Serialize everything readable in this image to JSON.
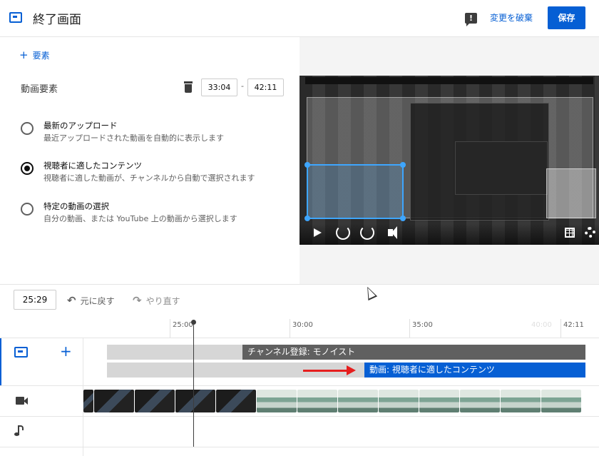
{
  "header": {
    "title": "終了画面",
    "discard_label": "変更を破棄",
    "save_label": "保存",
    "feedback_glyph": "!"
  },
  "left_panel": {
    "add_element_label": "要素",
    "video_element_label": "動画要素",
    "start_time": "33:04",
    "end_time": "42:11",
    "separator": "-",
    "options": [
      {
        "title": "最新のアップロード",
        "desc": "最近アップロードされた動画を自動的に表示します",
        "selected": false
      },
      {
        "title": "視聴者に適したコンテンツ",
        "desc": "視聴者に適した動画が、チャンネルから自動で選択されます",
        "selected": true
      },
      {
        "title": "特定の動画の選択",
        "desc": "自分の動画、または YouTube 上の動画から選択します",
        "selected": false
      }
    ]
  },
  "timeline": {
    "current_time": "25:29",
    "undo_label": "元に戻す",
    "redo_label": "やり直す",
    "ruler": [
      "25:00",
      "30:00",
      "35:00",
      "40:00",
      "42:11"
    ],
    "bar_channel_label": "チャンネル登録: モノイスト",
    "bar_video_label": "動画: 視聴者に適したコンテンツ"
  },
  "icons": {
    "endscreen": "end-screen-icon",
    "feedback": "feedback-icon",
    "trash": "trash-icon",
    "camera": "camera-icon",
    "music": "music-note-icon"
  },
  "colors": {
    "accent": "#065fd4",
    "channel_bar": "#606060",
    "arrow": "#e61e1e"
  }
}
